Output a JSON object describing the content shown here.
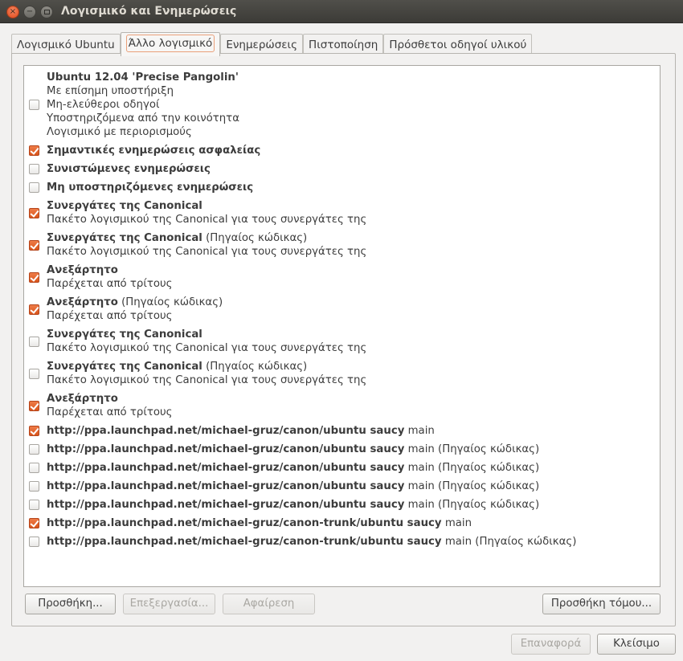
{
  "window": {
    "title": "Λογισμικό και Ενημερώσεις",
    "close_glyph": "×",
    "minimize_glyph": "−"
  },
  "tabs": [
    {
      "label": "Λογισμικό Ubuntu",
      "active": false
    },
    {
      "label": "Άλλο λογισμικό",
      "active": true
    },
    {
      "label": "Ενημερώσεις",
      "active": false
    },
    {
      "label": "Πιστοποίηση",
      "active": false
    },
    {
      "label": "Πρόσθετοι οδηγοί υλικού",
      "active": false
    }
  ],
  "sources": [
    {
      "checked": false,
      "title_bold": "Ubuntu 12.04 'Precise Pangolin'",
      "title_suffix": "",
      "lines": [
        "Με επίσημη υποστήριξη",
        "Μη-ελεύθεροι οδηγοί",
        "Υποστηριζόμενα από την κοινότητα",
        "Λογισμικό με περιορισμούς"
      ]
    },
    {
      "checked": true,
      "title_bold": "Σημαντικές ενημερώσεις ασφαλείας",
      "title_suffix": "",
      "lines": []
    },
    {
      "checked": false,
      "title_bold": "Συνιστώμενες ενημερώσεις",
      "title_suffix": "",
      "lines": []
    },
    {
      "checked": false,
      "title_bold": "Μη υποστηριζόμενες ενημερώσεις",
      "title_suffix": "",
      "lines": []
    },
    {
      "checked": true,
      "title_bold": "Συνεργάτες της Canonical",
      "title_suffix": "",
      "lines": [
        "Πακέτο λογισμικού της Canonical για τους συνεργάτες της"
      ]
    },
    {
      "checked": true,
      "title_bold": "Συνεργάτες της Canonical",
      "title_suffix": " (Πηγαίος κώδικας)",
      "lines": [
        "Πακέτο λογισμικού της Canonical για τους συνεργάτες της"
      ]
    },
    {
      "checked": true,
      "title_bold": "Ανεξάρτητο",
      "title_suffix": "",
      "lines": [
        "Παρέχεται από τρίτους"
      ]
    },
    {
      "checked": true,
      "title_bold": "Ανεξάρτητο",
      "title_suffix": " (Πηγαίος κώδικας)",
      "lines": [
        "Παρέχεται από τρίτους"
      ]
    },
    {
      "checked": false,
      "title_bold": "Συνεργάτες της Canonical",
      "title_suffix": "",
      "lines": [
        "Πακέτο λογισμικού της Canonical για τους συνεργάτες της"
      ]
    },
    {
      "checked": false,
      "title_bold": "Συνεργάτες της Canonical",
      "title_suffix": " (Πηγαίος κώδικας)",
      "lines": [
        "Πακέτο λογισμικού της Canonical για τους συνεργάτες της"
      ]
    },
    {
      "checked": true,
      "title_bold": "Ανεξάρτητο",
      "title_suffix": "",
      "lines": [
        "Παρέχεται από τρίτους"
      ]
    },
    {
      "checked": true,
      "title_bold": "http://ppa.launchpad.net/michael-gruz/canon/ubuntu saucy",
      "title_suffix": " main",
      "lines": []
    },
    {
      "checked": false,
      "title_bold": "http://ppa.launchpad.net/michael-gruz/canon/ubuntu saucy",
      "title_suffix": " main (Πηγαίος κώδικας)",
      "lines": []
    },
    {
      "checked": false,
      "title_bold": "http://ppa.launchpad.net/michael-gruz/canon/ubuntu saucy",
      "title_suffix": " main (Πηγαίος κώδικας)",
      "lines": []
    },
    {
      "checked": false,
      "title_bold": "http://ppa.launchpad.net/michael-gruz/canon/ubuntu saucy",
      "title_suffix": " main (Πηγαίος κώδικας)",
      "lines": []
    },
    {
      "checked": false,
      "title_bold": "http://ppa.launchpad.net/michael-gruz/canon/ubuntu saucy",
      "title_suffix": " main (Πηγαίος κώδικας)",
      "lines": []
    },
    {
      "checked": true,
      "title_bold": "http://ppa.launchpad.net/michael-gruz/canon-trunk/ubuntu saucy",
      "title_suffix": " main",
      "lines": []
    },
    {
      "checked": false,
      "title_bold": "http://ppa.launchpad.net/michael-gruz/canon-trunk/ubuntu saucy",
      "title_suffix": " main (Πηγαίος κώδικας)",
      "lines": []
    }
  ],
  "buttons": {
    "add": "Προσθήκη...",
    "edit": "Επεξεργασία...",
    "remove": "Αφαίρεση",
    "add_volume": "Προσθήκη τόμου...",
    "revert": "Επαναφορά",
    "close": "Κλείσιμο"
  },
  "colors": {
    "accent": "#dd4814",
    "titlebar": "#3c3b37"
  }
}
